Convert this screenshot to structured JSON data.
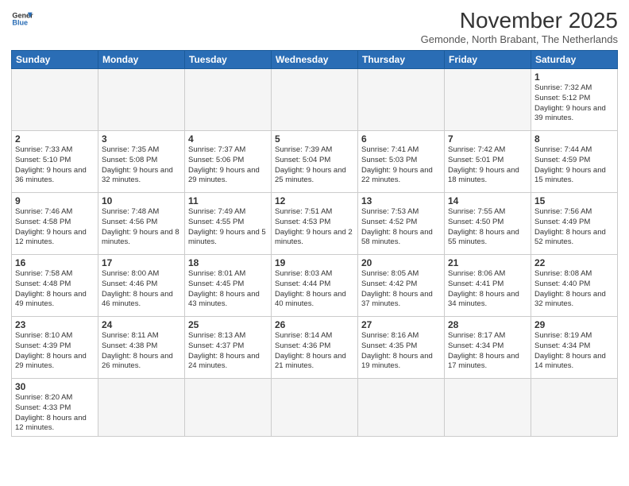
{
  "header": {
    "logo_line1": "General",
    "logo_line2": "Blue",
    "month_title": "November 2025",
    "subtitle": "Gemonde, North Brabant, The Netherlands"
  },
  "weekdays": [
    "Sunday",
    "Monday",
    "Tuesday",
    "Wednesday",
    "Thursday",
    "Friday",
    "Saturday"
  ],
  "days": [
    {
      "num": "",
      "info": "",
      "empty": true
    },
    {
      "num": "",
      "info": "",
      "empty": true
    },
    {
      "num": "",
      "info": "",
      "empty": true
    },
    {
      "num": "",
      "info": "",
      "empty": true
    },
    {
      "num": "",
      "info": "",
      "empty": true
    },
    {
      "num": "",
      "info": "",
      "empty": true
    },
    {
      "num": "1",
      "info": "Sunrise: 7:32 AM\nSunset: 5:12 PM\nDaylight: 9 hours\nand 39 minutes."
    },
    {
      "num": "2",
      "info": "Sunrise: 7:33 AM\nSunset: 5:10 PM\nDaylight: 9 hours\nand 36 minutes."
    },
    {
      "num": "3",
      "info": "Sunrise: 7:35 AM\nSunset: 5:08 PM\nDaylight: 9 hours\nand 32 minutes."
    },
    {
      "num": "4",
      "info": "Sunrise: 7:37 AM\nSunset: 5:06 PM\nDaylight: 9 hours\nand 29 minutes."
    },
    {
      "num": "5",
      "info": "Sunrise: 7:39 AM\nSunset: 5:04 PM\nDaylight: 9 hours\nand 25 minutes."
    },
    {
      "num": "6",
      "info": "Sunrise: 7:41 AM\nSunset: 5:03 PM\nDaylight: 9 hours\nand 22 minutes."
    },
    {
      "num": "7",
      "info": "Sunrise: 7:42 AM\nSunset: 5:01 PM\nDaylight: 9 hours\nand 18 minutes."
    },
    {
      "num": "8",
      "info": "Sunrise: 7:44 AM\nSunset: 4:59 PM\nDaylight: 9 hours\nand 15 minutes."
    },
    {
      "num": "9",
      "info": "Sunrise: 7:46 AM\nSunset: 4:58 PM\nDaylight: 9 hours\nand 12 minutes."
    },
    {
      "num": "10",
      "info": "Sunrise: 7:48 AM\nSunset: 4:56 PM\nDaylight: 9 hours\nand 8 minutes."
    },
    {
      "num": "11",
      "info": "Sunrise: 7:49 AM\nSunset: 4:55 PM\nDaylight: 9 hours\nand 5 minutes."
    },
    {
      "num": "12",
      "info": "Sunrise: 7:51 AM\nSunset: 4:53 PM\nDaylight: 9 hours\nand 2 minutes."
    },
    {
      "num": "13",
      "info": "Sunrise: 7:53 AM\nSunset: 4:52 PM\nDaylight: 8 hours\nand 58 minutes."
    },
    {
      "num": "14",
      "info": "Sunrise: 7:55 AM\nSunset: 4:50 PM\nDaylight: 8 hours\nand 55 minutes."
    },
    {
      "num": "15",
      "info": "Sunrise: 7:56 AM\nSunset: 4:49 PM\nDaylight: 8 hours\nand 52 minutes."
    },
    {
      "num": "16",
      "info": "Sunrise: 7:58 AM\nSunset: 4:48 PM\nDaylight: 8 hours\nand 49 minutes."
    },
    {
      "num": "17",
      "info": "Sunrise: 8:00 AM\nSunset: 4:46 PM\nDaylight: 8 hours\nand 46 minutes."
    },
    {
      "num": "18",
      "info": "Sunrise: 8:01 AM\nSunset: 4:45 PM\nDaylight: 8 hours\nand 43 minutes."
    },
    {
      "num": "19",
      "info": "Sunrise: 8:03 AM\nSunset: 4:44 PM\nDaylight: 8 hours\nand 40 minutes."
    },
    {
      "num": "20",
      "info": "Sunrise: 8:05 AM\nSunset: 4:42 PM\nDaylight: 8 hours\nand 37 minutes."
    },
    {
      "num": "21",
      "info": "Sunrise: 8:06 AM\nSunset: 4:41 PM\nDaylight: 8 hours\nand 34 minutes."
    },
    {
      "num": "22",
      "info": "Sunrise: 8:08 AM\nSunset: 4:40 PM\nDaylight: 8 hours\nand 32 minutes."
    },
    {
      "num": "23",
      "info": "Sunrise: 8:10 AM\nSunset: 4:39 PM\nDaylight: 8 hours\nand 29 minutes."
    },
    {
      "num": "24",
      "info": "Sunrise: 8:11 AM\nSunset: 4:38 PM\nDaylight: 8 hours\nand 26 minutes."
    },
    {
      "num": "25",
      "info": "Sunrise: 8:13 AM\nSunset: 4:37 PM\nDaylight: 8 hours\nand 24 minutes."
    },
    {
      "num": "26",
      "info": "Sunrise: 8:14 AM\nSunset: 4:36 PM\nDaylight: 8 hours\nand 21 minutes."
    },
    {
      "num": "27",
      "info": "Sunrise: 8:16 AM\nSunset: 4:35 PM\nDaylight: 8 hours\nand 19 minutes."
    },
    {
      "num": "28",
      "info": "Sunrise: 8:17 AM\nSunset: 4:34 PM\nDaylight: 8 hours\nand 17 minutes."
    },
    {
      "num": "29",
      "info": "Sunrise: 8:19 AM\nSunset: 4:34 PM\nDaylight: 8 hours\nand 14 minutes."
    },
    {
      "num": "30",
      "info": "Sunrise: 8:20 AM\nSunset: 4:33 PM\nDaylight: 8 hours\nand 12 minutes."
    },
    {
      "num": "",
      "info": "",
      "empty": true
    },
    {
      "num": "",
      "info": "",
      "empty": true
    },
    {
      "num": "",
      "info": "",
      "empty": true
    },
    {
      "num": "",
      "info": "",
      "empty": true
    },
    {
      "num": "",
      "info": "",
      "empty": true
    },
    {
      "num": "",
      "info": "",
      "empty": true
    }
  ]
}
